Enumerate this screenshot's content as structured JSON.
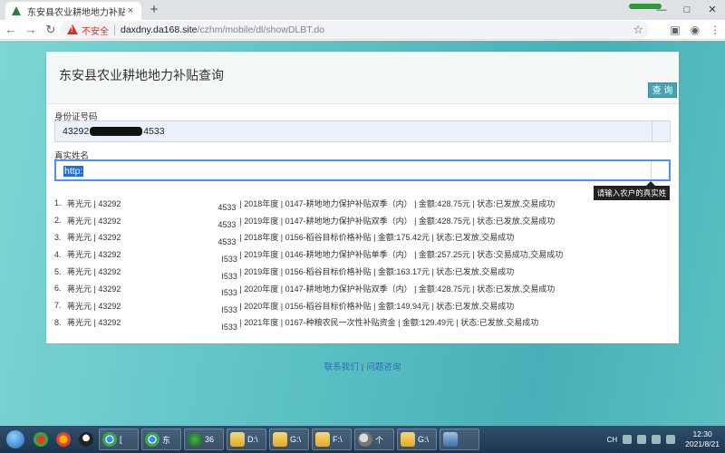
{
  "browser": {
    "tab_title": "东安县农业耕地地力补贴金额查询",
    "tab_close": "×",
    "new_tab": "+",
    "window_buttons": [
      "—",
      "□",
      "✕"
    ],
    "nav": {
      "back": "←",
      "forward": "→",
      "reload": "↻"
    },
    "security_label": "不安全",
    "url_host": "daxdny.da168.site",
    "url_path": "/czhm/mobile/dl/showDLBT.do",
    "star": "☆",
    "menu": "⋮"
  },
  "page": {
    "title": "东安县农业耕地地力补贴查询",
    "query_button": "查 询",
    "id_label": "身份证号码",
    "id_value_prefix": "43292",
    "id_value_suffix": "4533",
    "name_label": "真实姓名",
    "name_value": "http:",
    "tooltip": "请输入农户的真实姓名",
    "results": [
      {
        "num": "1.",
        "name": "蒋光元 | 43292",
        "id_tail": "4533",
        "rest": "| 2018年度 | 0147-耕地地力保护补贴双季（内） | 金额:428.75元 | 状态:已发放,交易成功"
      },
      {
        "num": "2.",
        "name": "蒋光元 | 43292",
        "id_tail": "4533",
        "rest": "| 2019年度 | 0147-耕地地力保护补贴双季（内） | 金额:428.75元 | 状态:已发放,交易成功"
      },
      {
        "num": "3.",
        "name": "蒋光元 | 43292",
        "id_tail": "4533",
        "rest": "| 2018年度 | 0156-稻谷目标价格补贴 | 金额:175.42元 | 状态:已发放,交易成功"
      },
      {
        "num": "4.",
        "name": "蒋光元 | 43292",
        "id_tail": "I533",
        "rest": "| 2019年度 | 0146-耕地地力保护补贴单季（内） | 金额:257.25元 | 状态:交易成功,交易成功"
      },
      {
        "num": "5.",
        "name": "蒋光元 | 43292",
        "id_tail": "I533",
        "rest": "| 2019年度 | 0156-稻谷目标价格补贴 | 金额:163.17元 | 状态:已发放,交易成功"
      },
      {
        "num": "6.",
        "name": "蒋光元 | 43292",
        "id_tail": "I533",
        "rest": "| 2020年度 | 0147-耕地地力保护补贴双季（内） | 金额:428.75元 | 状态:已发放,交易成功"
      },
      {
        "num": "7.",
        "name": "蒋光元 | 43292",
        "id_tail": "I533",
        "rest": "| 2020年度 | 0156-稻谷目标价格补贴 | 金额:149.94元 | 状态:已发放,交易成功"
      },
      {
        "num": "8.",
        "name": "蒋光元 | 43292",
        "id_tail": "I533",
        "rest": "| 2021年度 | 0167-种粮农民一次性补贴资金 | 金额:129.49元 | 状态:已发放,交易成功"
      }
    ],
    "footer_contact": "联系我们",
    "footer_divider": "|",
    "footer_help": "问题咨询"
  },
  "taskbar": {
    "apps": [
      {
        "label": "[",
        "icon": "chrome-icon"
      },
      {
        "label": "东",
        "icon": "chrome-icon"
      },
      {
        "label": "36",
        "icon": "browser-360-icon"
      },
      {
        "label": "D:\\",
        "icon": "folder-icon"
      },
      {
        "label": "G:\\",
        "icon": "folder-icon"
      },
      {
        "label": "F:\\",
        "icon": "folder-icon"
      },
      {
        "label": "个",
        "icon": "search-icon"
      },
      {
        "label": "G:\\",
        "icon": "folder-icon"
      },
      {
        "label": "",
        "icon": "monitor-icon"
      }
    ],
    "tray_lang": "CH",
    "time": "12:30",
    "date": "2021/8/21"
  },
  "colors": {
    "accent": "#45a3b3",
    "background": "#5fc3c6",
    "link": "#2a6fb3",
    "warning": "#d93025"
  }
}
